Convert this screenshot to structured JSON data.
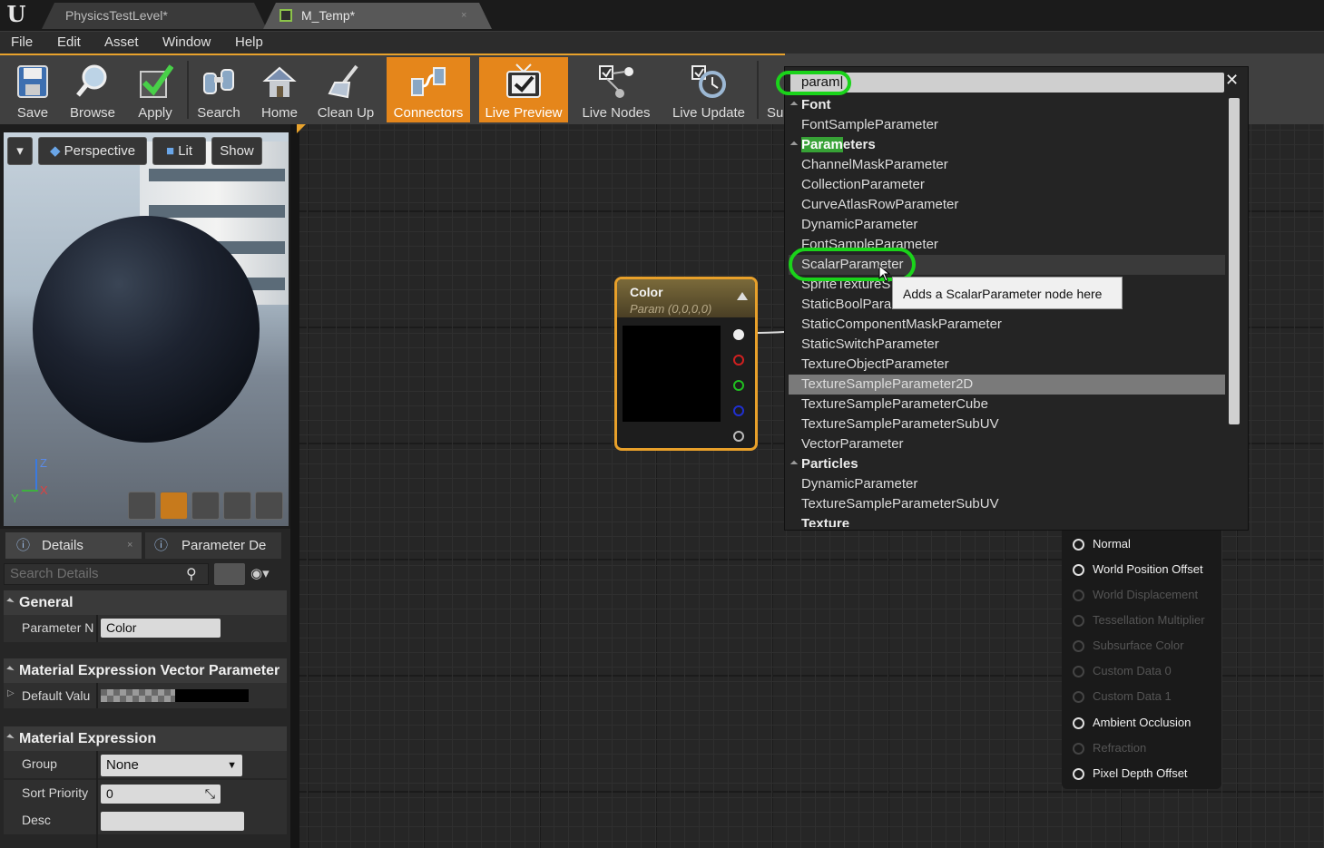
{
  "app": {
    "logo": "U"
  },
  "tabs": [
    {
      "label": "PhysicsTestLevel*"
    },
    {
      "label": "M_Temp*",
      "close": "×"
    }
  ],
  "menu": [
    "File",
    "Edit",
    "Asset",
    "Window",
    "Help"
  ],
  "toolbar": [
    {
      "label": "Save",
      "icon": "save-icon"
    },
    {
      "label": "Browse",
      "icon": "browse-icon"
    },
    {
      "label": "Apply",
      "icon": "apply-icon"
    },
    {
      "label": "Search",
      "icon": "binoculars-icon"
    },
    {
      "label": "Home",
      "icon": "home-icon"
    },
    {
      "label": "Clean Up",
      "icon": "broom-icon"
    },
    {
      "label": "Connectors",
      "icon": "connectors-icon",
      "active": true
    },
    {
      "label": "Live Preview",
      "icon": "tv-icon",
      "active": true
    },
    {
      "label": "Live Nodes",
      "icon": "live-nodes-icon"
    },
    {
      "label": "Live Update",
      "icon": "live-update-icon"
    },
    {
      "label": "Su",
      "icon": ""
    }
  ],
  "viewport": {
    "perspective": "Perspective",
    "lit": "Lit",
    "show": "Show",
    "axis_z": "Z",
    "axis_y": "Y",
    "axis_x": "X"
  },
  "details": {
    "tabs": [
      "Details",
      "Parameter De"
    ],
    "search_placeholder": "Search Details",
    "general": "General",
    "parameter_name_label": "Parameter N",
    "parameter_name_value": "Color",
    "vector_section": "Material Expression Vector Parameter",
    "default_value_label": "Default Valu",
    "expression_section": "Material Expression",
    "group_label": "Group",
    "group_value": "None",
    "sort_priority_label": "Sort Priority",
    "sort_priority_value": "0",
    "desc_label": "Desc"
  },
  "node": {
    "title": "Color",
    "subtitle": "Param (0,0,0,0)"
  },
  "search": {
    "query": "param",
    "close": "✕",
    "categories": [
      {
        "name": "Font",
        "items": [
          "FontSampleParameter"
        ]
      },
      {
        "name": "Parameters",
        "items": [
          "ChannelMaskParameter",
          "CollectionParameter",
          "CurveAtlasRowParameter",
          "DynamicParameter",
          "FontSampleParameter",
          "ScalarParameter",
          "SpriteTextureS",
          "StaticBoolPara",
          "StaticComponentMaskParameter",
          "StaticSwitchParameter",
          "TextureObjectParameter",
          "TextureSampleParameter2D",
          "TextureSampleParameterCube",
          "TextureSampleParameterSubUV",
          "VectorParameter"
        ]
      },
      {
        "name": "Particles",
        "items": [
          "DynamicParameter",
          "TextureSampleParameterSubUV"
        ]
      },
      {
        "name": "Texture",
        "items": []
      }
    ],
    "tooltip": "Adds a ScalarParameter node here"
  },
  "outputs": [
    {
      "label": "Normal",
      "enabled": true
    },
    {
      "label": "World Position Offset",
      "enabled": true
    },
    {
      "label": "World Displacement",
      "enabled": false
    },
    {
      "label": "Tessellation Multiplier",
      "enabled": false
    },
    {
      "label": "Subsurface Color",
      "enabled": false
    },
    {
      "label": "Custom Data 0",
      "enabled": false
    },
    {
      "label": "Custom Data 1",
      "enabled": false
    },
    {
      "label": "Ambient Occlusion",
      "enabled": true
    },
    {
      "label": "Refraction",
      "enabled": false
    },
    {
      "label": "Pixel Depth Offset",
      "enabled": true
    }
  ]
}
